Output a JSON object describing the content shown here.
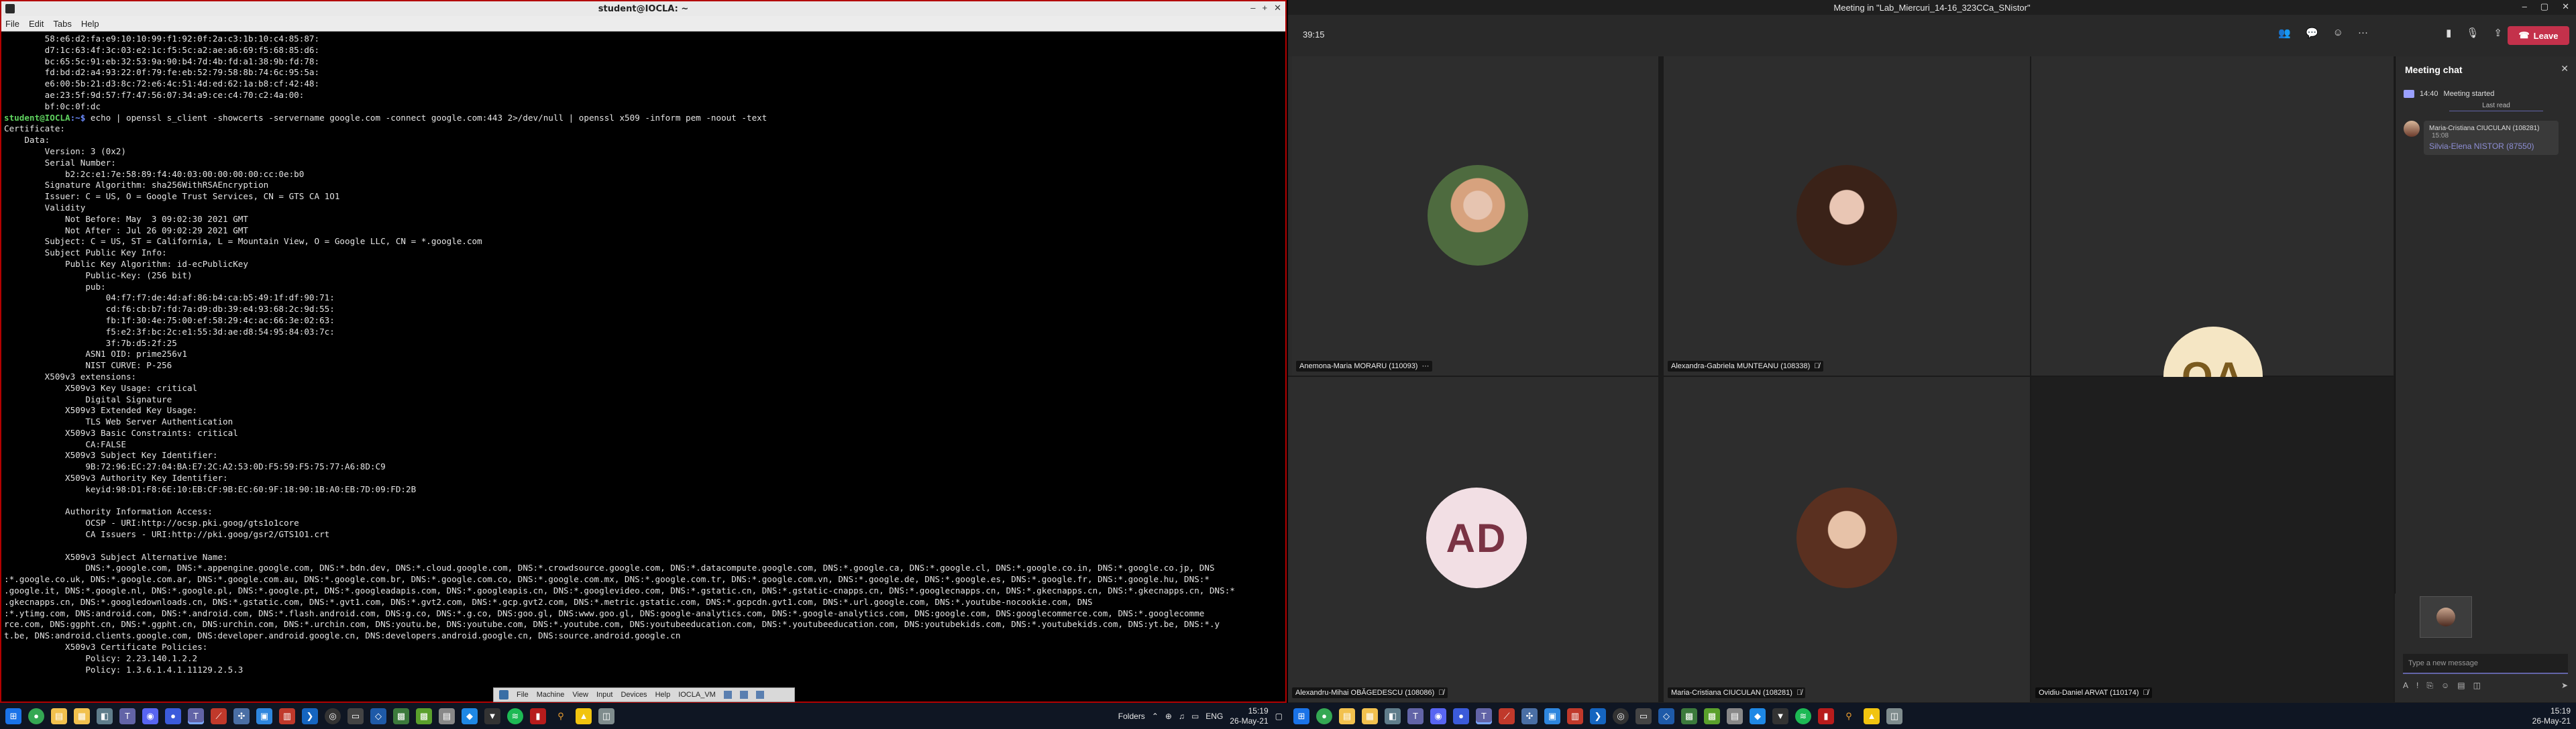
{
  "terminal": {
    "window_title": "student@IOCLA: ~",
    "menu": [
      "File",
      "Edit",
      "Tabs",
      "Help"
    ],
    "prompt_user": "student@IOCLA",
    "prompt_path": ":~$",
    "command": " echo | openssl s_client -showcerts -servername google.com -connect google.com:443 2>/dev/null | openssl x509 -inform pem -noout -text",
    "pre_lines": [
      "        58:e6:d2:fa:e9:10:10:99:f1:92:0f:2a:c3:1b:10:c4:85:87:",
      "        d7:1c:63:4f:3c:03:e2:1c:f5:5c:a2:ae:a6:69:f5:68:85:d6:",
      "        bc:65:5c:91:eb:32:53:9a:90:b4:7d:4b:fd:a1:38:9b:fd:78:",
      "        fd:bd:d2:a4:93:22:0f:79:fe:eb:52:79:58:8b:74:6c:95:5a:",
      "        e6:00:5b:21:d3:8c:72:e6:4c:51:4d:ed:62:1a:b8:cf:42:48:",
      "        ae:23:5f:9d:57:f7:47:56:07:34:a9:ce:c4:70:c2:4a:00:",
      "        bf:0c:0f:dc"
    ],
    "output": "Certificate:\n    Data:\n        Version: 3 (0x2)\n        Serial Number:\n            b2:2c:e1:7e:58:89:f4:40:03:00:00:00:00:cc:0e:b0\n        Signature Algorithm: sha256WithRSAEncryption\n        Issuer: C = US, O = Google Trust Services, CN = GTS CA 1O1\n        Validity\n            Not Before: May  3 09:02:30 2021 GMT\n            Not After : Jul 26 09:02:29 2021 GMT\n        Subject: C = US, ST = California, L = Mountain View, O = Google LLC, CN = *.google.com\n        Subject Public Key Info:\n            Public Key Algorithm: id-ecPublicKey\n                Public-Key: (256 bit)\n                pub:\n                    04:f7:f7:de:4d:af:86:b4:ca:b5:49:1f:df:90:71:\n                    cd:f6:cb:b7:fd:7a:d9:db:39:e4:93:68:2c:9d:55:\n                    fb:1f:30:4e:75:00:ef:58:29:4c:ac:66:3e:02:63:\n                    f5:e2:3f:bc:2c:e1:55:3d:ae:d8:54:95:84:03:7c:\n                    3f:7b:d5:2f:25\n                ASN1 OID: prime256v1\n                NIST CURVE: P-256\n        X509v3 extensions:\n            X509v3 Key Usage: critical\n                Digital Signature\n            X509v3 Extended Key Usage:\n                TLS Web Server Authentication\n            X509v3 Basic Constraints: critical\n                CA:FALSE\n            X509v3 Subject Key Identifier:\n                9B:72:96:EC:27:04:BA:E7:2C:A2:53:0D:F5:59:F5:75:77:A6:8D:C9\n            X509v3 Authority Key Identifier:\n                keyid:98:D1:F8:6E:10:EB:CF:9B:EC:60:9F:18:90:1B:A0:EB:7D:09:FD:2B\n\n            Authority Information Access:\n                OCSP - URI:http://ocsp.pki.goog/gts1o1core\n                CA Issuers - URI:http://pki.goog/gsr2/GTS1O1.crt\n\n            X509v3 Subject Alternative Name:\n                DNS:*.google.com, DNS:*.appengine.google.com, DNS:*.bdn.dev, DNS:*.cloud.google.com, DNS:*.crowdsource.google.com, DNS:*.datacompute.google.com, DNS:*.google.ca, DNS:*.google.cl, DNS:*.google.co.in, DNS:*.google.co.jp, DNS\n:*.google.co.uk, DNS:*.google.com.ar, DNS:*.google.com.au, DNS:*.google.com.br, DNS:*.google.com.co, DNS:*.google.com.mx, DNS:*.google.com.tr, DNS:*.google.com.vn, DNS:*.google.de, DNS:*.google.es, DNS:*.google.fr, DNS:*.google.hu, DNS:*\n.google.it, DNS:*.google.nl, DNS:*.google.pl, DNS:*.google.pt, DNS:*.googleadapis.com, DNS:*.googleapis.cn, DNS:*.googlevideo.com, DNS:*.gstatic.cn, DNS:*.gstatic-cnapps.cn, DNS:*.googlecnapps.cn, DNS:*.gkecnapps.cn, DNS:*.gkecnapps.cn, DNS:*\n.gkecnapps.cn, DNS:*.googledownloads.cn, DNS:*.gstatic.com, DNS:*.gvt1.com, DNS:*.gvt2.com, DNS:*.gcp.gvt2.com, DNS:*.metric.gstatic.com, DNS:*.gcpcdn.gvt1.com, DNS:*.url.google.com, DNS:*.youtube-nocookie.com, DNS\n:*.ytimg.com, DNS:android.com, DNS:*.android.com, DNS:*.flash.android.com, DNS:g.co, DNS:*.g.co, DNS:goo.gl, DNS:www.goo.gl, DNS:google-analytics.com, DNS:*.google-analytics.com, DNS:google.com, DNS:googlecommerce.com, DNS:*.googlecomme\nrce.com, DNS:ggpht.cn, DNS:*.ggpht.cn, DNS:urchin.com, DNS:*.urchin.com, DNS:youtu.be, DNS:youtube.com, DNS:*.youtube.com, DNS:youtubeeducation.com, DNS:*.youtubeeducation.com, DNS:youtubekids.com, DNS:*.youtubekids.com, DNS:yt.be, DNS:*.y\nt.be, DNS:android.clients.google.com, DNS:developer.android.google.cn, DNS:developers.android.google.cn, DNS:source.android.google.cn\n            X509v3 Certificate Policies:\n                Policy: 2.23.140.1.2.2\n                Policy: 1.3.6.1.4.1.11129.2.5.3"
  },
  "vm_toolbar": {
    "items": [
      "File",
      "Machine",
      "View",
      "Input",
      "Devices",
      "Help"
    ],
    "vm_name": "IOCLA_VM"
  },
  "left_taskbar": {
    "folders_label": "Folders",
    "lang": "ENG",
    "time": "15:19",
    "date": "26-May-21"
  },
  "teams": {
    "window_title": "Meeting in \"Lab_Miercuri_14-16_323CCa_SNistor\"",
    "timer": "39:15",
    "leave_label": "Leave",
    "participants": [
      {
        "name": "Anemona-Maria MORARU (110093)",
        "type": "photo",
        "extra": "···"
      },
      {
        "name": "Alexandra-Gabriela MUNTEANU (108338)",
        "type": "photo",
        "extra": "mic-off"
      },
      {
        "name": "",
        "type": "initials",
        "initials": "OA",
        "bg": "#f5e6c4",
        "fg": "#7a5a1e"
      },
      {
        "name": "Alexandru-Mihai OBĂGEDESCU (108086)",
        "type": "initials",
        "initials": "AD",
        "bg": "#f2dfe4",
        "fg": "#7a3344",
        "extra": "mic-off"
      },
      {
        "name": "Maria-Cristiana CIUCULAN (108281)",
        "type": "photo",
        "extra": "mic-off"
      },
      {
        "name": "Ovidiu-Daniel ARVAT (110174)",
        "type": "empty",
        "extra": "mic-off"
      }
    ],
    "chat": {
      "title": "Meeting chat",
      "system_time": "14:40",
      "system_text": "Meeting started",
      "last_read": "Last read",
      "messages": [
        {
          "who": "Maria-Cristiana CIUCULAN (108281)",
          "time": "15:08",
          "text": "Silvia-Elena NISTOR (87550)"
        }
      ],
      "compose_placeholder": "Type a new message"
    }
  },
  "right_taskbar": {
    "time": "15:19",
    "date": "26-May-21"
  },
  "colors": {
    "leave": "#c4314b",
    "teams_accent": "#6264a7",
    "terminal_border": "#b30000"
  }
}
